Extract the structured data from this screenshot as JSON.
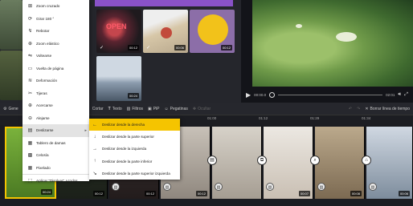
{
  "media_thumbs": {
    "durations": [
      "00:12",
      "00:06",
      "00:12",
      "00:24"
    ],
    "sign_text": "OPEN"
  },
  "preview": {
    "time_current": "00:00.0",
    "time_total": "02:01"
  },
  "toolbar": {
    "items": [
      "Gene",
      "Cortar",
      "Texto",
      "Filtros",
      "PiP",
      "Pegatinas",
      "Ocultar"
    ],
    "divider_label": "Borrar línea de tiempo"
  },
  "ruler": {
    "ticks": [
      "01:00",
      "01:05",
      "01:12",
      "01:29",
      "01:34"
    ]
  },
  "timeline": {
    "durations": [
      "00:24",
      "00:12",
      "00:12",
      "00:12",
      "00:07",
      "00:08",
      "00:06"
    ]
  },
  "effects_menu": {
    "items": [
      {
        "label": "Zoom cruzado",
        "icon": "crossed-zoom-icon"
      },
      {
        "label": "Girar 180 °",
        "icon": "rotate-icon"
      },
      {
        "label": "Rebotar",
        "icon": "bounce-icon"
      },
      {
        "label": "Zoom elástico",
        "icon": "elastic-zoom-icon"
      },
      {
        "label": "Voltearse",
        "icon": "flip-icon"
      },
      {
        "label": "Vuelta de página",
        "icon": "page-turn-icon"
      },
      {
        "label": "Deformación",
        "icon": "warp-icon"
      },
      {
        "label": "Tijeras",
        "icon": "scissors-icon"
      },
      {
        "label": "Acercarse",
        "icon": "zoom-in-icon"
      },
      {
        "label": "Alejarse",
        "icon": "zoom-out-icon"
      },
      {
        "label": "Deslizarse",
        "icon": "slide-icon"
      },
      {
        "label": "Tablero de damas",
        "icon": "checkerboard-icon"
      },
      {
        "label": "Celosía",
        "icon": "lattice-icon"
      },
      {
        "label": "Pixelado",
        "icon": "pixelate-icon"
      },
      {
        "label": "Aplicar \"Disolver\" a todos",
        "icon": "apply-all-icon"
      }
    ]
  },
  "slide_submenu": {
    "items": [
      {
        "label": "Deslizar desde la derecha"
      },
      {
        "label": "Deslizar desde la parte superior"
      },
      {
        "label": "Deslizar desde la izquierda"
      },
      {
        "label": "Deslizar desde la parte inferior"
      },
      {
        "label": "Deslizar desde la parte superior izquierda"
      }
    ]
  }
}
